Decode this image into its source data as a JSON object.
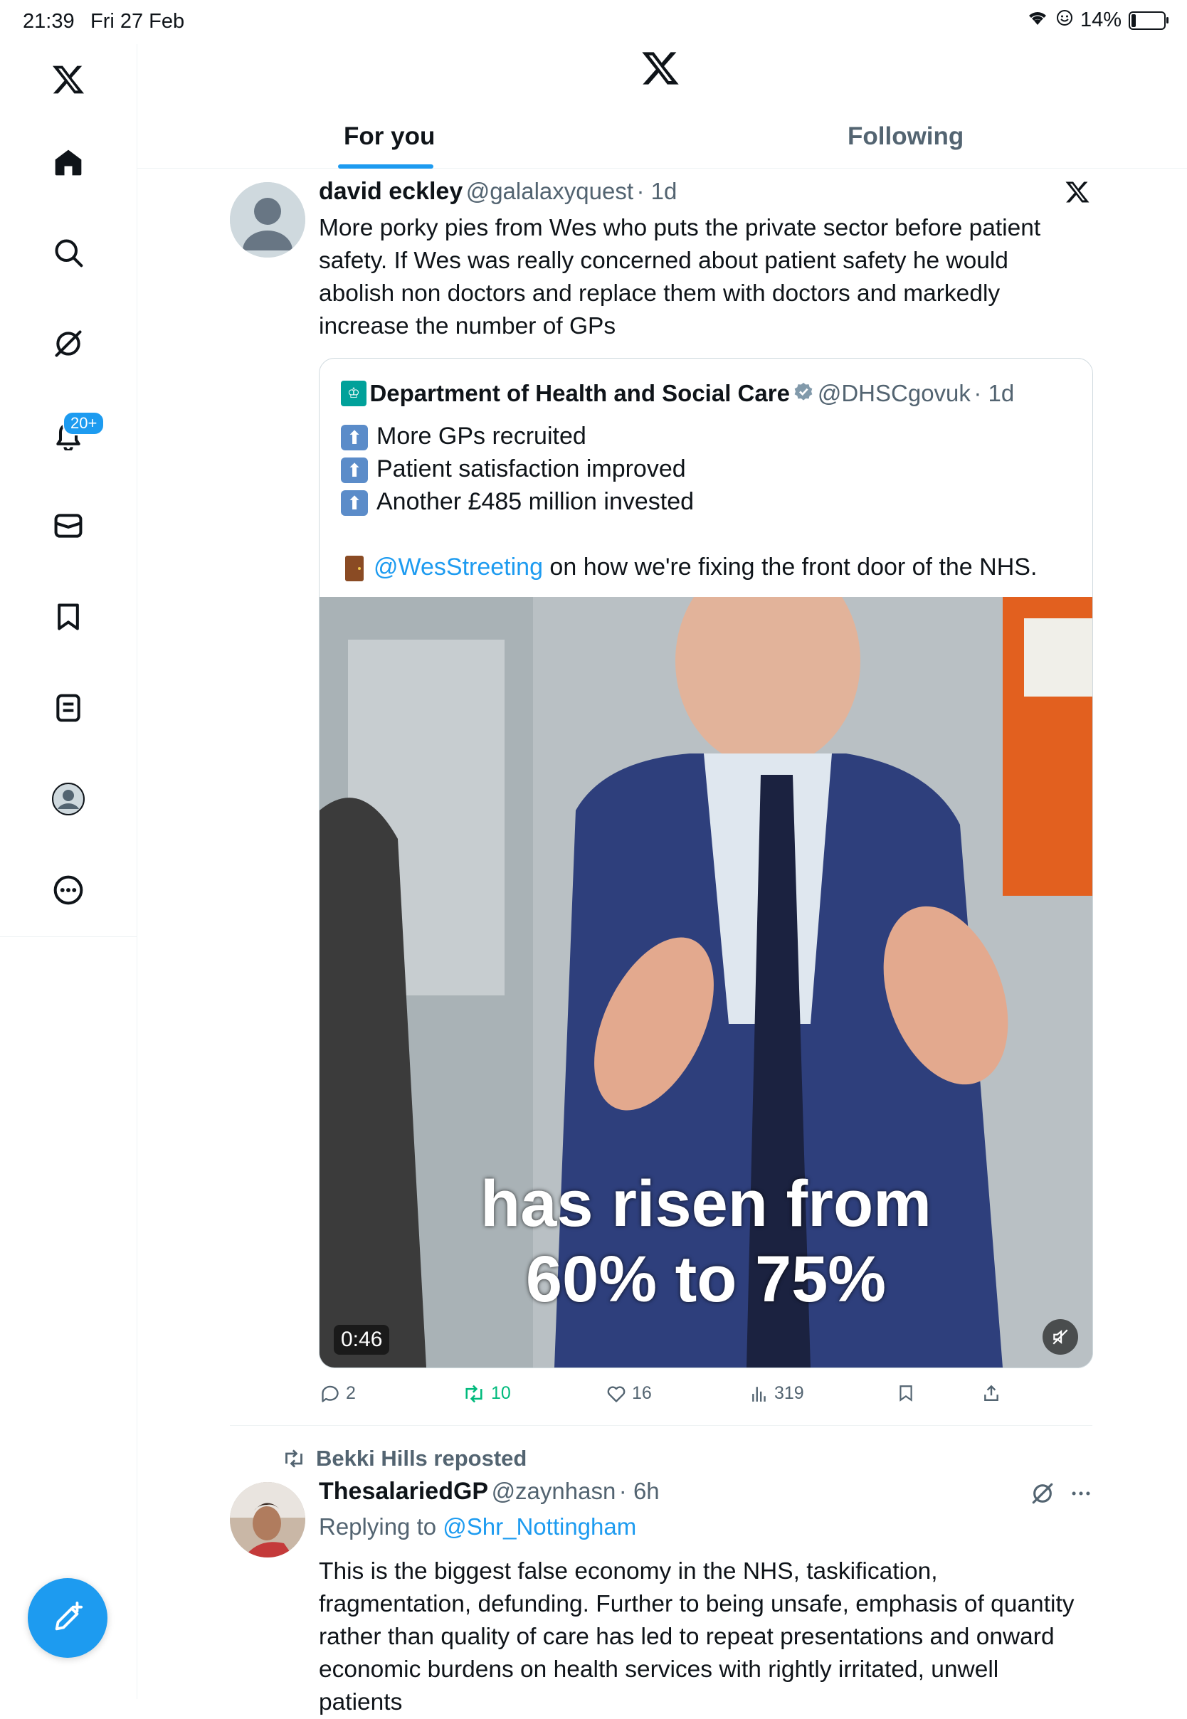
{
  "status_bar": {
    "time": "21:39",
    "date": "Fri 27 Feb",
    "battery": "14%",
    "battery_level": 0.14
  },
  "sidebar": {
    "notifications_badge": "20+"
  },
  "tabs": [
    {
      "label": "For you"
    },
    {
      "label": "Following"
    }
  ],
  "tweet1": {
    "name": "david eckley",
    "handle": "@galalaxyquest",
    "time": "· 1d",
    "text": "More porky pies from Wes who puts the private sector before patient safety. If Wes was really concerned about patient safety he would abolish non doctors and replace them with doctors and markedly increase the number of GPs",
    "quote": {
      "name": "Department of Health and Social Care",
      "handle": "@DHSCgovuk",
      "time": "· 1d",
      "lines": [
        "More GPs recruited",
        "Patient satisfaction improved",
        "Another £485 million invested"
      ],
      "mention": "@WesStreeting",
      "mention_rest": " on how we're fixing the front door of the NHS.",
      "video": {
        "caption_line1": "has risen from",
        "caption_line2": "60% to 75%",
        "duration": "0:46"
      }
    },
    "stats": {
      "replies": "2",
      "reposts": "10",
      "likes": "16",
      "views": "319"
    }
  },
  "tweet2": {
    "repost_label": "Bekki Hills reposted",
    "name": "ThesalariedGP",
    "handle": "@zaynhasn",
    "time": "· 6h",
    "replying_prefix": "Replying to ",
    "replying_to": "@Shr_Nottingham",
    "text": "This is the biggest false economy in the NHS, taskification, fragmentation, defunding. Further to being unsafe, emphasis of quantity rather than quality of care has led to repeat presentations and onward economic burdens on health services with rightly irritated, unwell patients"
  },
  "colors": {
    "accent": "#1d9bf0",
    "muted": "#536471",
    "repost_green": "#00ba7c",
    "text": "#0f1419"
  }
}
